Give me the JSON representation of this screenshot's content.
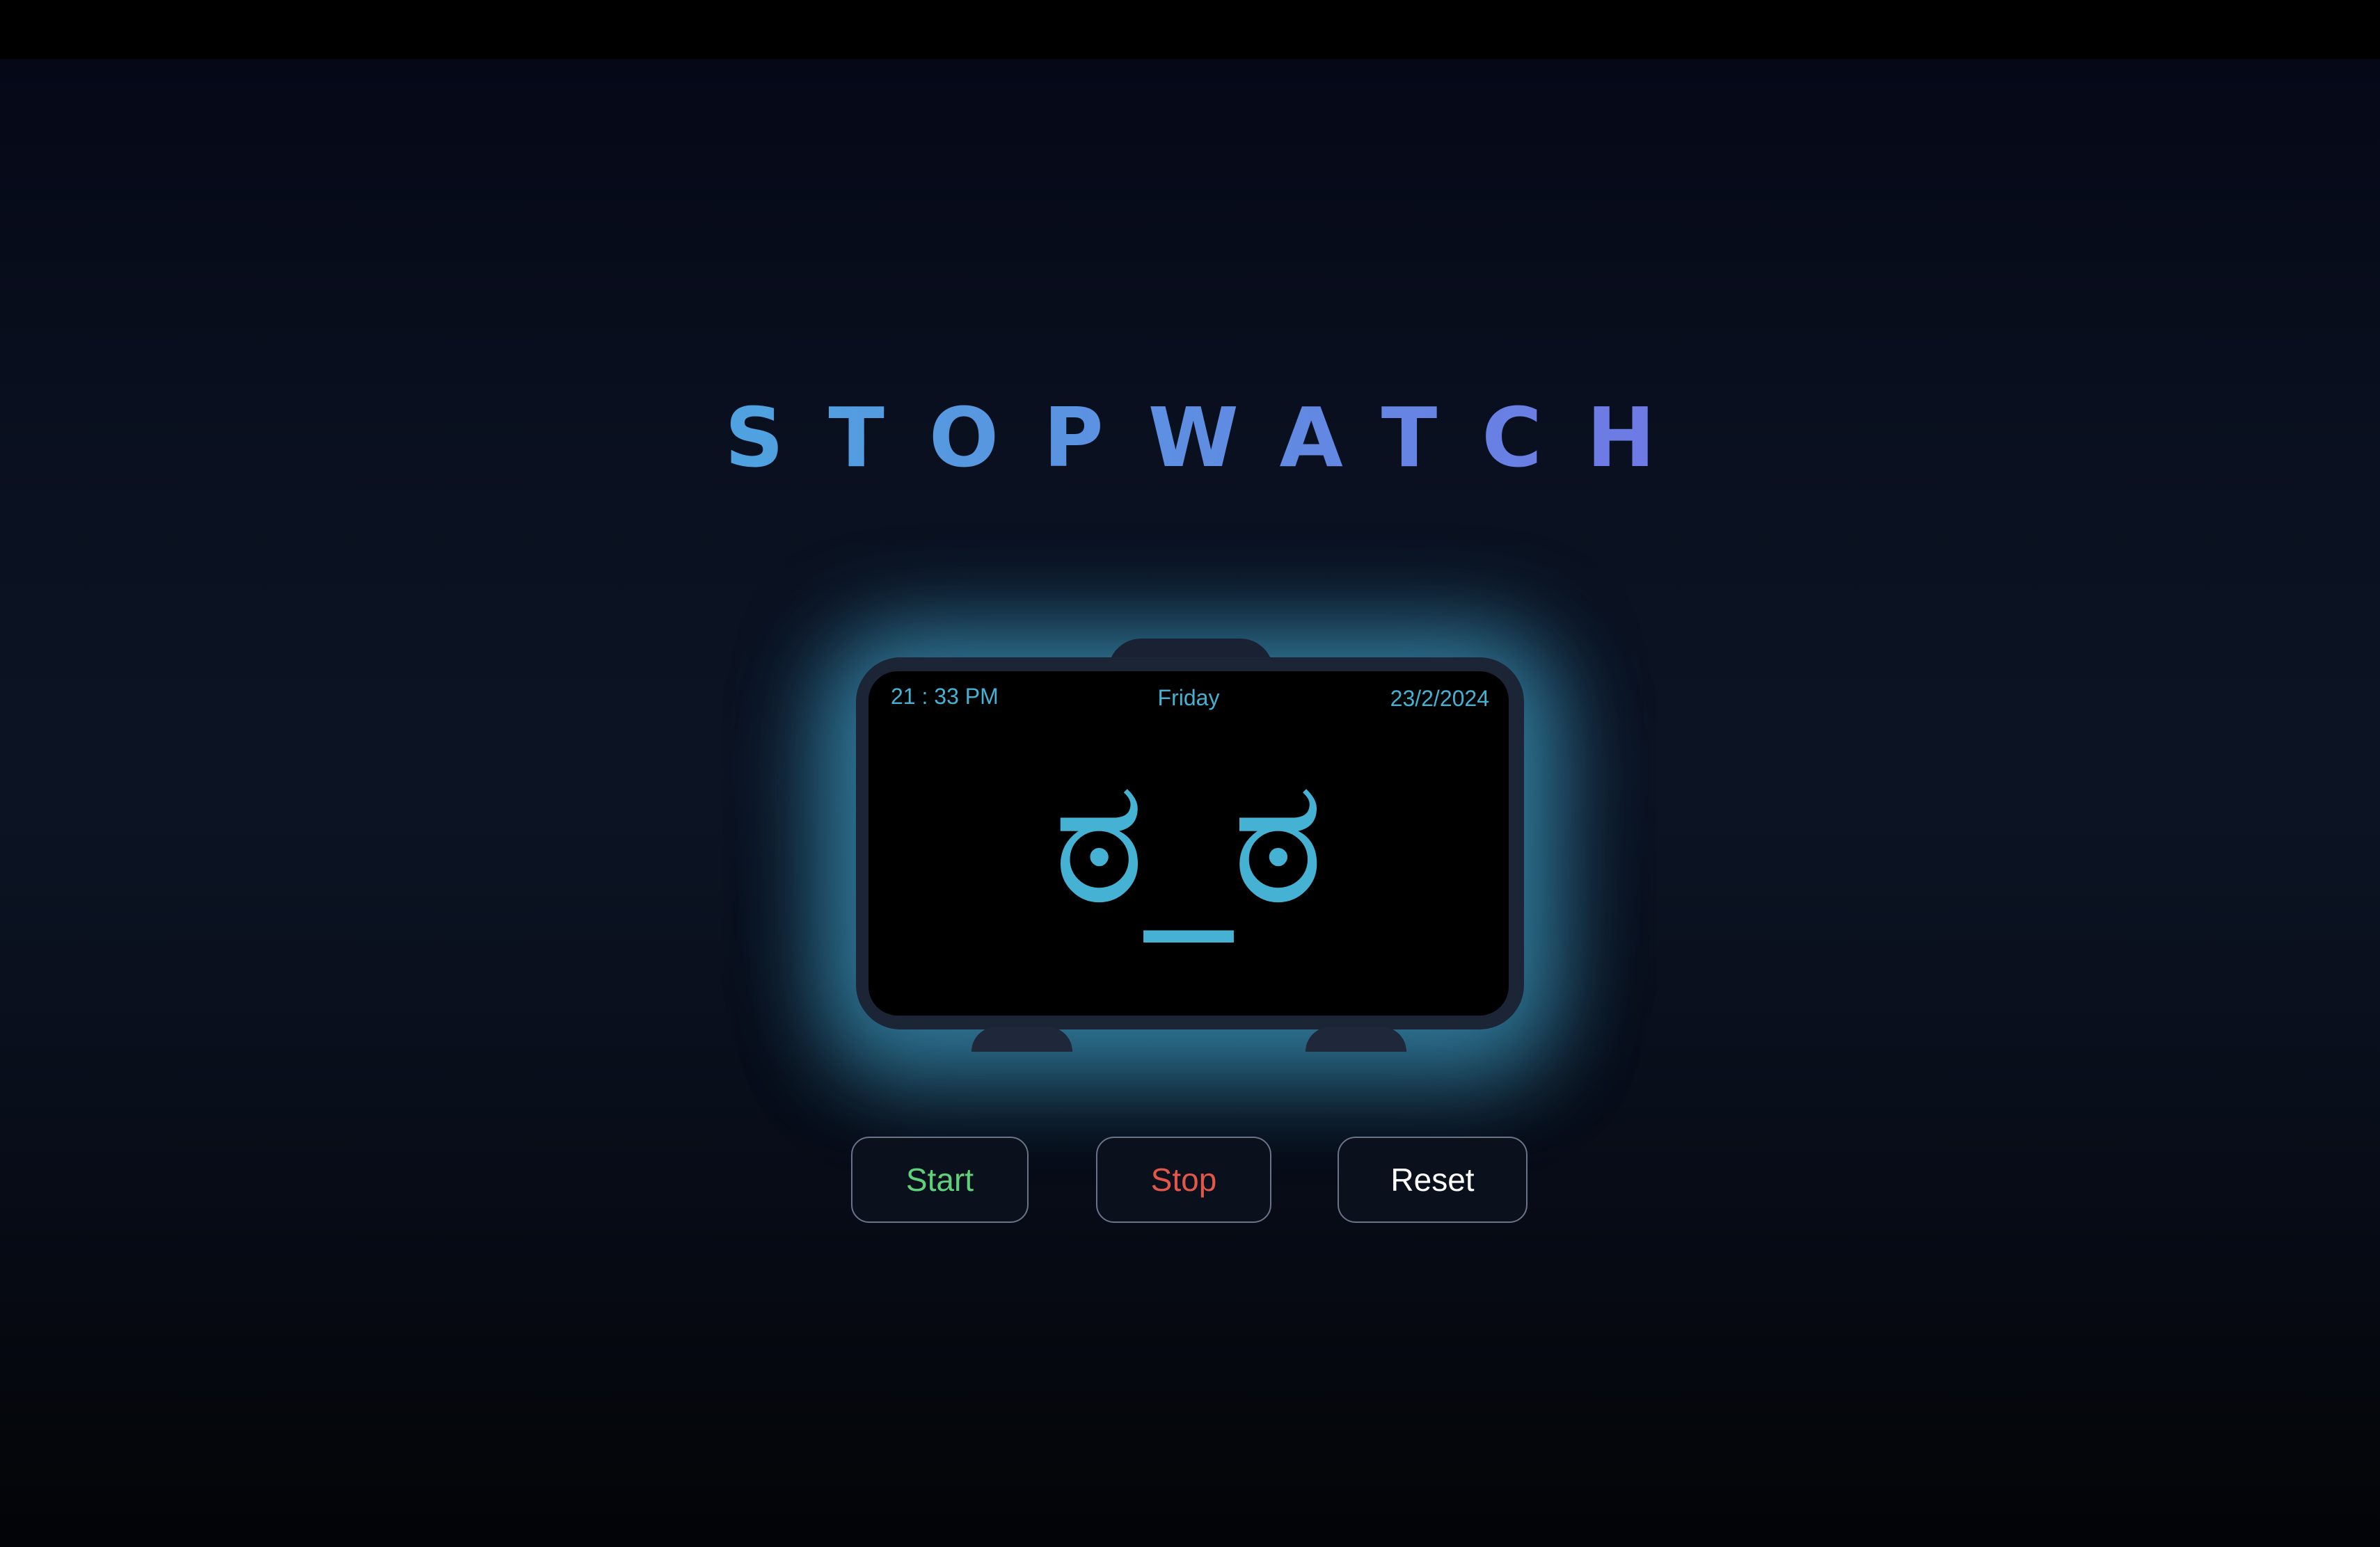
{
  "app": {
    "title": "STOPWATCH"
  },
  "display": {
    "time": "21 : 33 PM",
    "day": "Friday",
    "date": "23/2/2024",
    "face": "ಠ_ಠ"
  },
  "controls": {
    "start_label": "Start",
    "stop_label": "Stop",
    "reset_label": "Reset"
  },
  "colors": {
    "accent": "#45b2d4",
    "start": "#5fd17a",
    "stop": "#e3574a",
    "reset": "#ffffff",
    "title_gradient_start": "#39b9d6",
    "title_gradient_end": "#8a62e6"
  }
}
